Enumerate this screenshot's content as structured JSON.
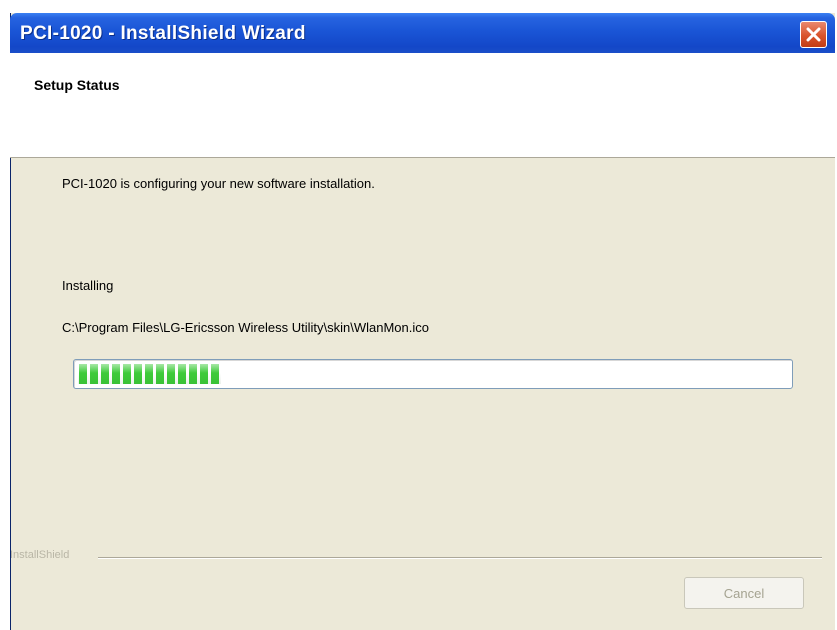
{
  "window": {
    "title": "PCI-1020 - InstallShield Wizard"
  },
  "header": {
    "title": "Setup Status"
  },
  "main": {
    "status_message": "PCI-1020 is configuring your new software installation.",
    "installing_label": "Installing",
    "current_file": "C:\\Program Files\\LG-Ericsson Wireless Utility\\skin\\WlanMon.ico",
    "progress_fraction": 0.2
  },
  "footer": {
    "brand": "InstallShield",
    "cancel_label": "Cancel"
  },
  "colors": {
    "titlebar": "#1a55d6",
    "progress": "#3ecb3a",
    "close": "#d9532c"
  },
  "icons": {
    "close": "close-icon"
  }
}
